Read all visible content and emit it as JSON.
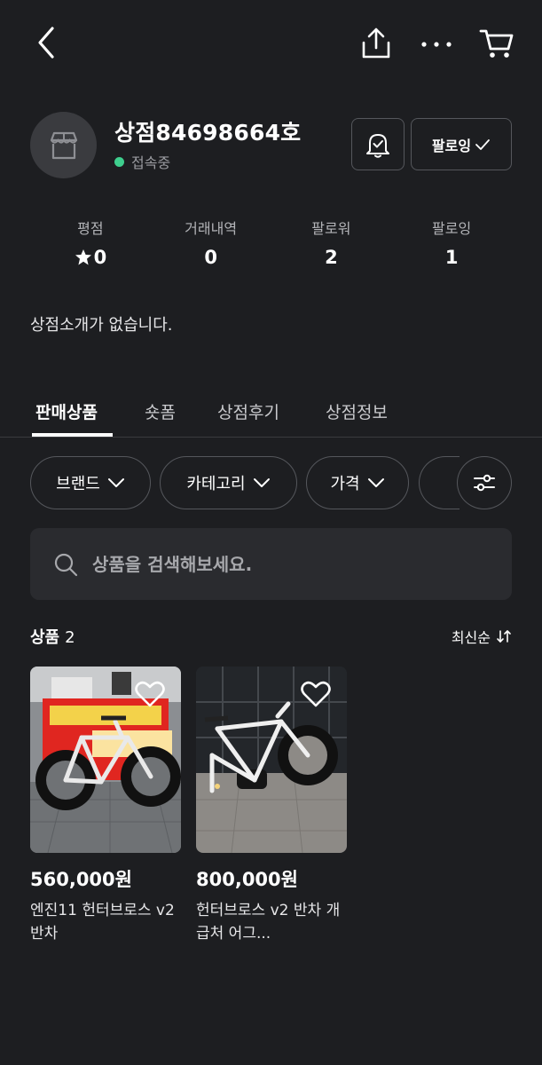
{
  "shop": {
    "name": "상점84698664호",
    "status": "접속중",
    "follow_label": "팔로잉",
    "intro": "상점소개가 없습니다."
  },
  "stats": [
    {
      "label": "평점",
      "value": "0"
    },
    {
      "label": "거래내역",
      "value": "0"
    },
    {
      "label": "팔로워",
      "value": "2"
    },
    {
      "label": "팔로잉",
      "value": "1"
    }
  ],
  "tabs": [
    {
      "label": "판매상품"
    },
    {
      "label": "숏폼"
    },
    {
      "label": "상점후기"
    },
    {
      "label": "상점정보"
    }
  ],
  "filters": [
    {
      "label": "브랜드"
    },
    {
      "label": "카테고리"
    },
    {
      "label": "가격"
    }
  ],
  "search": {
    "placeholder": "상품을 검색해보세요."
  },
  "products_header": {
    "label": "상품",
    "count": "2",
    "sort_label": "최신순"
  },
  "products": [
    {
      "price": "560,000원",
      "title": "엔진11 헌터브로스 v2 반차"
    },
    {
      "price": "800,000원",
      "title": "헌터브로스 v2 반차 개급처 어그..."
    }
  ],
  "colors": {
    "background": "#1d1e21",
    "online": "#3ecf8e",
    "surface": "#2a2b2f"
  }
}
